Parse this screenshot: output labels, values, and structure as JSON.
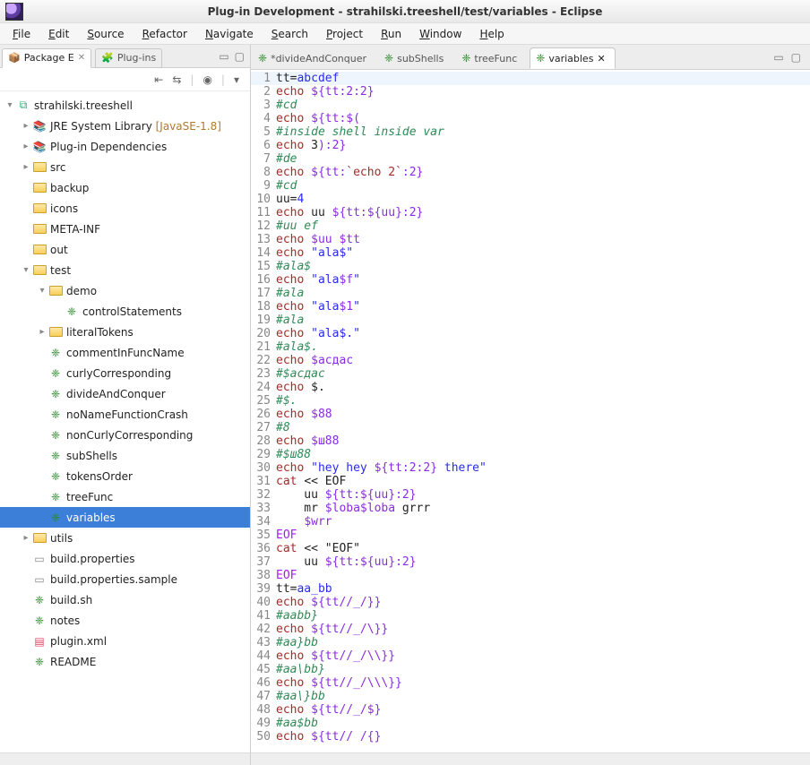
{
  "window": {
    "title": "Plug-in Development - strahilski.treeshell/test/variables - Eclipse"
  },
  "menus": [
    "File",
    "Edit",
    "Source",
    "Refactor",
    "Navigate",
    "Search",
    "Project",
    "Run",
    "Window",
    "Help"
  ],
  "sidebar_tabs": [
    {
      "label": "Package E",
      "active": true
    },
    {
      "label": "Plug-ins",
      "active": false
    }
  ],
  "tree": [
    {
      "depth": 1,
      "expander": "▾",
      "icon": "project",
      "label": "strahilski.treeshell"
    },
    {
      "depth": 2,
      "expander": "▸",
      "icon": "lib",
      "label": "JRE System Library",
      "suffix": " [JavaSE-1.8]"
    },
    {
      "depth": 2,
      "expander": "▸",
      "icon": "lib",
      "label": "Plug-in Dependencies"
    },
    {
      "depth": 2,
      "expander": "▸",
      "icon": "folder-src",
      "label": "src"
    },
    {
      "depth": 2,
      "expander": "",
      "icon": "folder",
      "label": "backup"
    },
    {
      "depth": 2,
      "expander": "",
      "icon": "folder",
      "label": "icons"
    },
    {
      "depth": 2,
      "expander": "",
      "icon": "folder",
      "label": "META-INF"
    },
    {
      "depth": 2,
      "expander": "",
      "icon": "folder",
      "label": "out"
    },
    {
      "depth": 2,
      "expander": "▾",
      "icon": "folder",
      "label": "test"
    },
    {
      "depth": 3,
      "expander": "▾",
      "icon": "folder",
      "label": "demo"
    },
    {
      "depth": 4,
      "expander": "",
      "icon": "tree",
      "label": "controlStatements"
    },
    {
      "depth": 3,
      "expander": "▸",
      "icon": "folder",
      "label": "literalTokens"
    },
    {
      "depth": 3,
      "expander": "",
      "icon": "tree",
      "label": "commentInFuncName"
    },
    {
      "depth": 3,
      "expander": "",
      "icon": "tree",
      "label": "curlyCorresponding"
    },
    {
      "depth": 3,
      "expander": "",
      "icon": "tree",
      "label": "divideAndConquer"
    },
    {
      "depth": 3,
      "expander": "",
      "icon": "tree",
      "label": "noNameFunctionCrash"
    },
    {
      "depth": 3,
      "expander": "",
      "icon": "tree",
      "label": "nonCurlyCorresponding"
    },
    {
      "depth": 3,
      "expander": "",
      "icon": "tree",
      "label": "subShells"
    },
    {
      "depth": 3,
      "expander": "",
      "icon": "tree",
      "label": "tokensOrder"
    },
    {
      "depth": 3,
      "expander": "",
      "icon": "tree",
      "label": "treeFunc"
    },
    {
      "depth": 3,
      "expander": "",
      "icon": "tree",
      "label": "variables",
      "selected": true
    },
    {
      "depth": 2,
      "expander": "▸",
      "icon": "folder",
      "label": "utils"
    },
    {
      "depth": 2,
      "expander": "",
      "icon": "file",
      "label": "build.properties"
    },
    {
      "depth": 2,
      "expander": "",
      "icon": "file",
      "label": "build.properties.sample"
    },
    {
      "depth": 2,
      "expander": "",
      "icon": "tree",
      "label": "build.sh"
    },
    {
      "depth": 2,
      "expander": "",
      "icon": "tree",
      "label": "notes"
    },
    {
      "depth": 2,
      "expander": "",
      "icon": "xml",
      "label": "plugin.xml"
    },
    {
      "depth": 2,
      "expander": "",
      "icon": "tree",
      "label": "README"
    }
  ],
  "editor_tabs": [
    {
      "label": "*divideAndConquer",
      "active": false
    },
    {
      "label": "subShells",
      "active": false
    },
    {
      "label": "treeFunc",
      "active": false
    },
    {
      "label": "variables",
      "active": true
    }
  ],
  "code": [
    {
      "n": 1,
      "current": true,
      "segs": [
        {
          "t": "tt",
          "c": ""
        },
        {
          "t": "=",
          "c": ""
        },
        {
          "t": "abcdef",
          "c": "c-s"
        }
      ]
    },
    {
      "n": 2,
      "segs": [
        {
          "t": "echo ",
          "c": "c-k"
        },
        {
          "t": "${tt:2:2}",
          "c": "c-v"
        }
      ]
    },
    {
      "n": 3,
      "segs": [
        {
          "t": "#cd",
          "c": "c-c"
        }
      ]
    },
    {
      "n": 4,
      "segs": [
        {
          "t": "echo ",
          "c": "c-k"
        },
        {
          "t": "${tt:$(",
          "c": "c-v"
        }
      ]
    },
    {
      "n": 5,
      "segs": [
        {
          "t": "#inside shell inside var",
          "c": "c-c"
        }
      ]
    },
    {
      "n": 6,
      "segs": [
        {
          "t": "echo ",
          "c": "c-k"
        },
        {
          "t": "3",
          "c": ""
        },
        {
          "t": "):2}",
          "c": "c-v"
        }
      ]
    },
    {
      "n": 7,
      "segs": [
        {
          "t": "#de",
          "c": "c-c"
        }
      ]
    },
    {
      "n": 8,
      "segs": [
        {
          "t": "echo ",
          "c": "c-k"
        },
        {
          "t": "${tt:",
          "c": "c-v"
        },
        {
          "t": "`echo 2`",
          "c": "c-b"
        },
        {
          "t": ":2}",
          "c": "c-v"
        }
      ]
    },
    {
      "n": 9,
      "segs": [
        {
          "t": "#cd",
          "c": "c-c"
        }
      ]
    },
    {
      "n": 10,
      "segs": [
        {
          "t": "uu",
          "c": ""
        },
        {
          "t": "=",
          "c": ""
        },
        {
          "t": "4",
          "c": "c-s"
        }
      ]
    },
    {
      "n": 11,
      "segs": [
        {
          "t": "echo ",
          "c": "c-k"
        },
        {
          "t": "uu ",
          "c": ""
        },
        {
          "t": "${tt:${uu}:2}",
          "c": "c-v"
        }
      ]
    },
    {
      "n": 12,
      "segs": [
        {
          "t": "#uu ef",
          "c": "c-c"
        }
      ]
    },
    {
      "n": 13,
      "segs": [
        {
          "t": "echo ",
          "c": "c-k"
        },
        {
          "t": "$uu",
          "c": "c-v"
        },
        {
          "t": " ",
          "c": ""
        },
        {
          "t": "$tt",
          "c": "c-v"
        }
      ]
    },
    {
      "n": 14,
      "segs": [
        {
          "t": "echo ",
          "c": "c-k"
        },
        {
          "t": "\"ala$\"",
          "c": "c-s"
        }
      ]
    },
    {
      "n": 15,
      "segs": [
        {
          "t": "#ala$",
          "c": "c-c"
        }
      ]
    },
    {
      "n": 16,
      "segs": [
        {
          "t": "echo ",
          "c": "c-k"
        },
        {
          "t": "\"ala",
          "c": "c-s"
        },
        {
          "t": "$f",
          "c": "c-v"
        },
        {
          "t": "\"",
          "c": "c-s"
        }
      ]
    },
    {
      "n": 17,
      "segs": [
        {
          "t": "#ala",
          "c": "c-c"
        }
      ]
    },
    {
      "n": 18,
      "segs": [
        {
          "t": "echo ",
          "c": "c-k"
        },
        {
          "t": "\"ala",
          "c": "c-s"
        },
        {
          "t": "$1",
          "c": "c-v"
        },
        {
          "t": "\"",
          "c": "c-s"
        }
      ]
    },
    {
      "n": 19,
      "segs": [
        {
          "t": "#ala",
          "c": "c-c"
        }
      ]
    },
    {
      "n": 20,
      "segs": [
        {
          "t": "echo ",
          "c": "c-k"
        },
        {
          "t": "\"ala$.\"",
          "c": "c-s"
        }
      ]
    },
    {
      "n": 21,
      "segs": [
        {
          "t": "#ala$.",
          "c": "c-c"
        }
      ]
    },
    {
      "n": 22,
      "segs": [
        {
          "t": "echo ",
          "c": "c-k"
        },
        {
          "t": "$асдас",
          "c": "c-v"
        }
      ]
    },
    {
      "n": 23,
      "segs": [
        {
          "t": "#$асдас",
          "c": "c-c"
        }
      ]
    },
    {
      "n": 24,
      "segs": [
        {
          "t": "echo ",
          "c": "c-k"
        },
        {
          "t": "$.",
          "c": ""
        }
      ]
    },
    {
      "n": 25,
      "segs": [
        {
          "t": "#$.",
          "c": "c-c"
        }
      ]
    },
    {
      "n": 26,
      "segs": [
        {
          "t": "echo ",
          "c": "c-k"
        },
        {
          "t": "$88",
          "c": "c-v"
        }
      ]
    },
    {
      "n": 27,
      "segs": [
        {
          "t": "#8",
          "c": "c-c"
        }
      ]
    },
    {
      "n": 28,
      "segs": [
        {
          "t": "echo ",
          "c": "c-k"
        },
        {
          "t": "$ш88",
          "c": "c-v"
        }
      ]
    },
    {
      "n": 29,
      "segs": [
        {
          "t": "#$ш88",
          "c": "c-c"
        }
      ]
    },
    {
      "n": 30,
      "segs": [
        {
          "t": "echo ",
          "c": "c-k"
        },
        {
          "t": "\"hey hey ",
          "c": "c-s"
        },
        {
          "t": "${tt:2:2}",
          "c": "c-v"
        },
        {
          "t": " there\"",
          "c": "c-s"
        }
      ]
    },
    {
      "n": 31,
      "segs": [
        {
          "t": "cat ",
          "c": "c-k"
        },
        {
          "t": "<< EOF",
          "c": ""
        }
      ]
    },
    {
      "n": 32,
      "segs": [
        {
          "t": "    uu ",
          "c": ""
        },
        {
          "t": "${tt:${uu}:2}",
          "c": "c-v"
        }
      ]
    },
    {
      "n": 33,
      "segs": [
        {
          "t": "    mr ",
          "c": ""
        },
        {
          "t": "$loba$loba",
          "c": "c-v"
        },
        {
          "t": " grrr",
          "c": ""
        }
      ]
    },
    {
      "n": 34,
      "segs": [
        {
          "t": "    ",
          "c": ""
        },
        {
          "t": "$wrr",
          "c": "c-v"
        }
      ]
    },
    {
      "n": 35,
      "segs": [
        {
          "t": "EOF",
          "c": "c-h"
        }
      ]
    },
    {
      "n": 36,
      "segs": [
        {
          "t": "cat ",
          "c": "c-k"
        },
        {
          "t": "<< \"EOF\"",
          "c": ""
        }
      ]
    },
    {
      "n": 37,
      "segs": [
        {
          "t": "    uu ",
          "c": ""
        },
        {
          "t": "${tt:${uu}:2}",
          "c": "c-v"
        }
      ]
    },
    {
      "n": 38,
      "segs": [
        {
          "t": "EOF",
          "c": "c-h"
        }
      ]
    },
    {
      "n": 39,
      "segs": [
        {
          "t": "tt",
          "c": ""
        },
        {
          "t": "=",
          "c": ""
        },
        {
          "t": "aa_bb",
          "c": "c-s"
        }
      ]
    },
    {
      "n": 40,
      "segs": [
        {
          "t": "echo ",
          "c": "c-k"
        },
        {
          "t": "${tt//_/}}",
          "c": "c-v"
        }
      ]
    },
    {
      "n": 41,
      "segs": [
        {
          "t": "#aabb}",
          "c": "c-c"
        }
      ]
    },
    {
      "n": 42,
      "segs": [
        {
          "t": "echo ",
          "c": "c-k"
        },
        {
          "t": "${tt//_/\\}}",
          "c": "c-v"
        }
      ]
    },
    {
      "n": 43,
      "segs": [
        {
          "t": "#aa}bb",
          "c": "c-c"
        }
      ]
    },
    {
      "n": 44,
      "segs": [
        {
          "t": "echo ",
          "c": "c-k"
        },
        {
          "t": "${tt//_/\\\\}}",
          "c": "c-v"
        }
      ]
    },
    {
      "n": 45,
      "segs": [
        {
          "t": "#aa\\bb}",
          "c": "c-c"
        }
      ]
    },
    {
      "n": 46,
      "segs": [
        {
          "t": "echo ",
          "c": "c-k"
        },
        {
          "t": "${tt//_/\\\\\\}}",
          "c": "c-v"
        }
      ]
    },
    {
      "n": 47,
      "segs": [
        {
          "t": "#aa\\}bb",
          "c": "c-c"
        }
      ]
    },
    {
      "n": 48,
      "segs": [
        {
          "t": "echo ",
          "c": "c-k"
        },
        {
          "t": "${tt//_/$}",
          "c": "c-v"
        }
      ]
    },
    {
      "n": 49,
      "segs": [
        {
          "t": "#aa$bb",
          "c": "c-c"
        }
      ]
    },
    {
      "n": 50,
      "segs": [
        {
          "t": "echo ",
          "c": "c-k"
        },
        {
          "t": "${tt// /{}",
          "c": "c-v"
        }
      ]
    }
  ]
}
